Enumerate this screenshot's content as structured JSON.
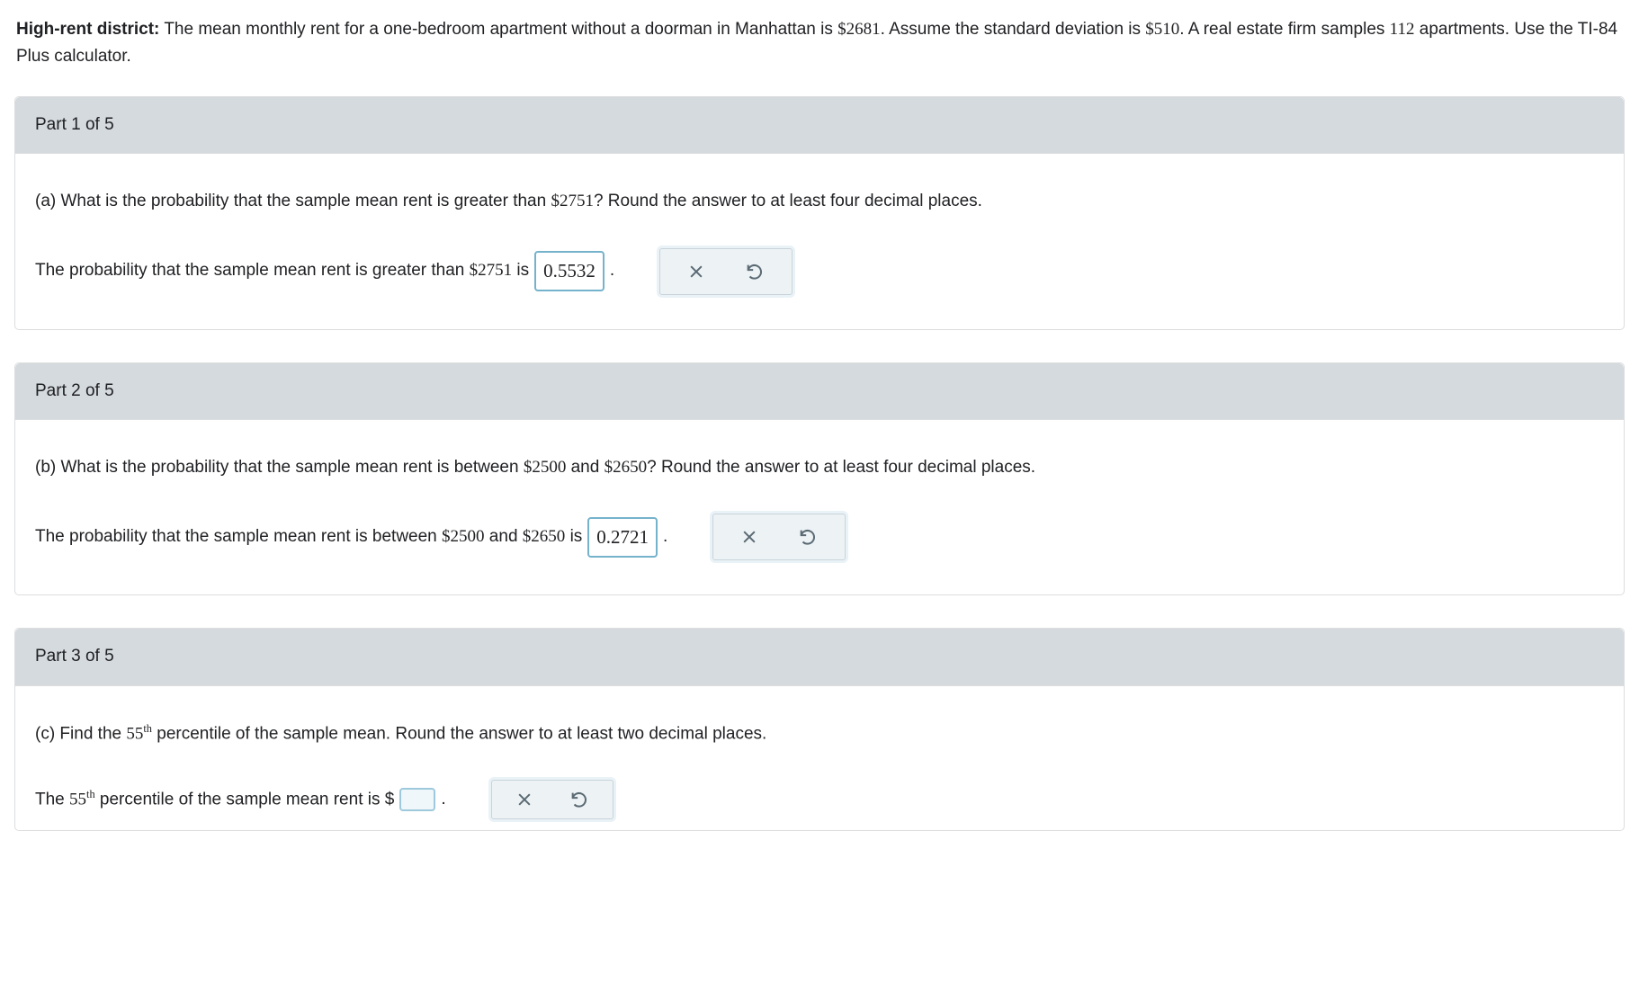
{
  "intro": {
    "title_bold": "High-rent district:",
    "text_1": " The mean monthly rent for a one-bedroom apartment without a doorman in Manhattan is ",
    "mean": "$2681",
    "text_2": ". Assume the standard deviation is ",
    "sd": "$510",
    "text_3": ". A real estate firm samples ",
    "n": "112",
    "text_4": " apartments. Use the TI-84 Plus calculator."
  },
  "parts": {
    "p1": {
      "header": "Part 1 of 5",
      "q_prefix": "(a) What is the probability that the sample mean rent is greater than ",
      "q_value": "$2751",
      "q_suffix": "? Round the answer to at least four decimal places.",
      "a_prefix": "The probability that the sample mean rent is greater than ",
      "a_value": "$2751",
      "a_mid": " is ",
      "answer": "0.5532",
      "a_suffix": "."
    },
    "p2": {
      "header": "Part 2 of 5",
      "q_prefix": "(b) What is the probability that the sample mean rent is between ",
      "q_v1": "$2500",
      "q_mid": " and ",
      "q_v2": "$2650",
      "q_suffix": "? Round the answer to at least four decimal places.",
      "a_prefix": "The probability that the sample mean rent is between ",
      "a_v1": "$2500",
      "a_mid1": " and ",
      "a_v2": "$2650",
      "a_mid2": " is ",
      "answer": "0.2721",
      "a_suffix": "."
    },
    "p3": {
      "header": "Part 3 of 5",
      "q_prefix": "(c) Find the ",
      "q_pct": "55",
      "q_sup": "th",
      "q_suffix": " percentile of the sample mean. Round the answer to at least two decimal places.",
      "a_prefix": "The ",
      "a_pct": "55",
      "a_sup": "th",
      "a_mid": " percentile of the sample mean rent is  $",
      "answer": "",
      "a_suffix": "."
    }
  }
}
